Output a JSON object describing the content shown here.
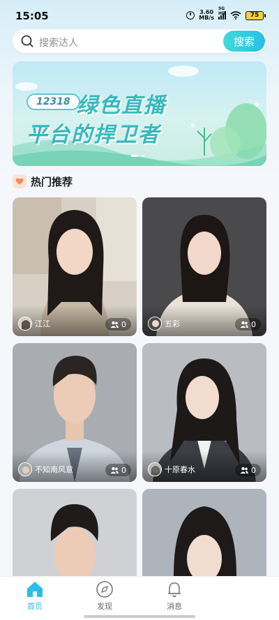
{
  "status_bar": {
    "time": "15:05",
    "net_speed_value": "3.60",
    "net_speed_unit": "MB/s",
    "signal_tag": "5G HD",
    "battery": "75"
  },
  "search": {
    "placeholder": "搜索达人",
    "button_label": "搜索"
  },
  "banner": {
    "badge": "12318",
    "line1": "绿色直播",
    "line2": "平台的捍卫者"
  },
  "section": {
    "title": "热门推荐"
  },
  "cards": [
    {
      "name": "江江",
      "count": "0"
    },
    {
      "name": "五彩",
      "count": "0"
    },
    {
      "name": "不知南风意",
      "count": "0"
    },
    {
      "name": "十原春水",
      "count": "0"
    }
  ],
  "tabs": [
    {
      "label": "首页",
      "icon": "home-icon",
      "active": true
    },
    {
      "label": "发现",
      "icon": "compass-icon",
      "active": false
    },
    {
      "label": "消息",
      "icon": "bell-icon",
      "active": false
    }
  ],
  "colors": {
    "accent": "#2bbde8",
    "banner_text": "#36b8bd"
  }
}
